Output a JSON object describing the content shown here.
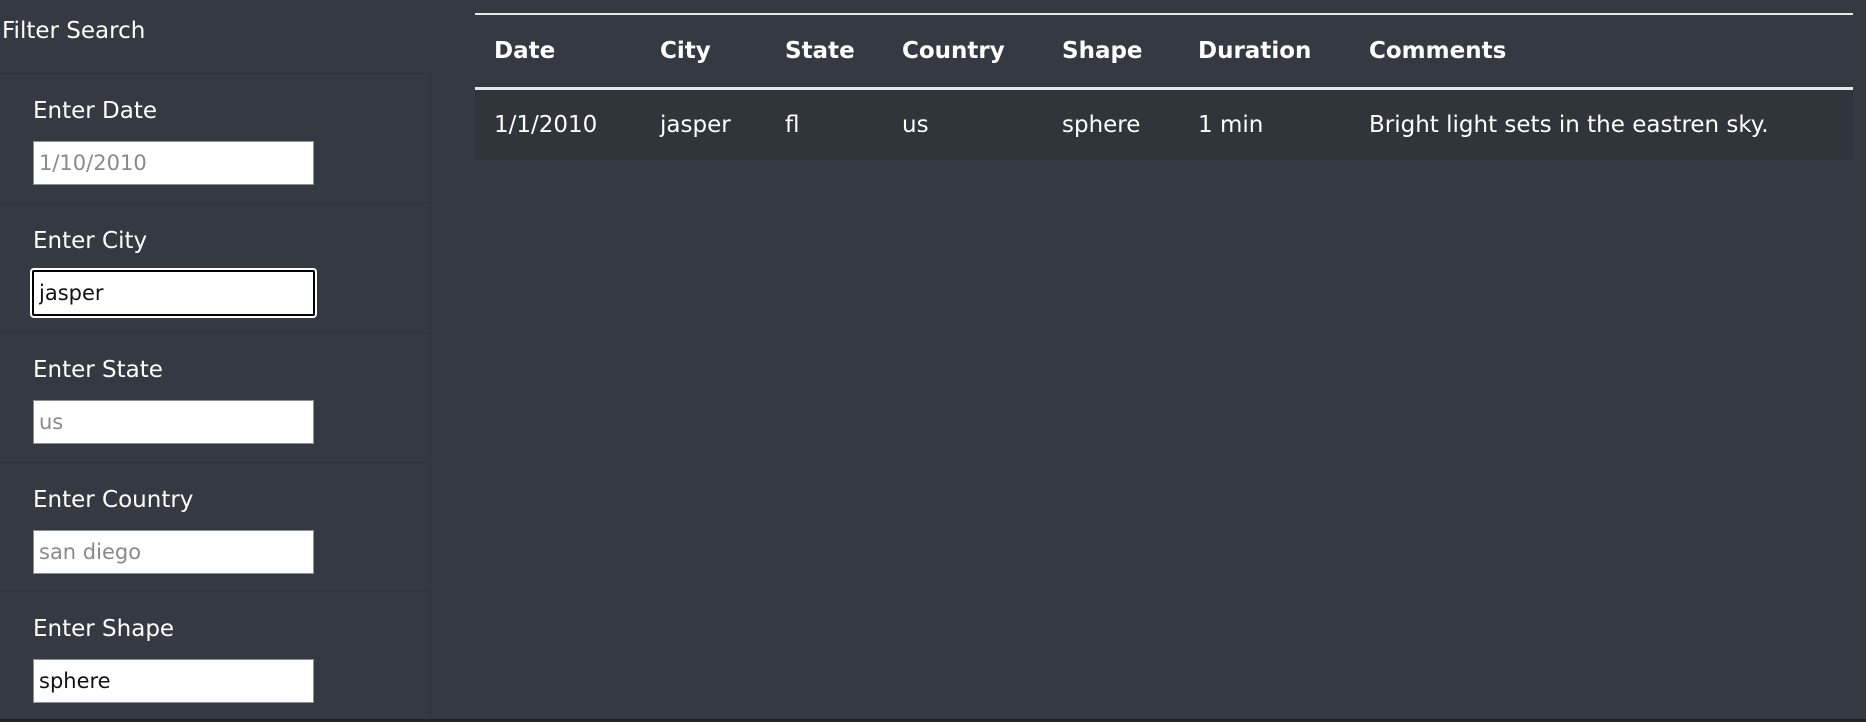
{
  "sidebar": {
    "title": "Filter Search",
    "filters": [
      {
        "label": "Enter Date",
        "value": "",
        "placeholder": "1/10/2010"
      },
      {
        "label": "Enter City",
        "value": "jasper",
        "placeholder": ""
      },
      {
        "label": "Enter State",
        "value": "",
        "placeholder": "us"
      },
      {
        "label": "Enter Country",
        "value": "",
        "placeholder": "san diego"
      },
      {
        "label": "Enter Shape",
        "value": "sphere",
        "placeholder": ""
      }
    ]
  },
  "table": {
    "columns": [
      "Date",
      "City",
      "State",
      "Country",
      "Shape",
      "Duration",
      "Comments"
    ],
    "rows": [
      [
        "1/1/2010",
        "jasper",
        "fl",
        "us",
        "sphere",
        "1 min",
        "Bright light sets in the eastren sky."
      ]
    ]
  },
  "colors": {
    "background": "#353a42",
    "row_background": "#30353c",
    "text": "#ffffff",
    "rule": "#e8e8e8"
  }
}
